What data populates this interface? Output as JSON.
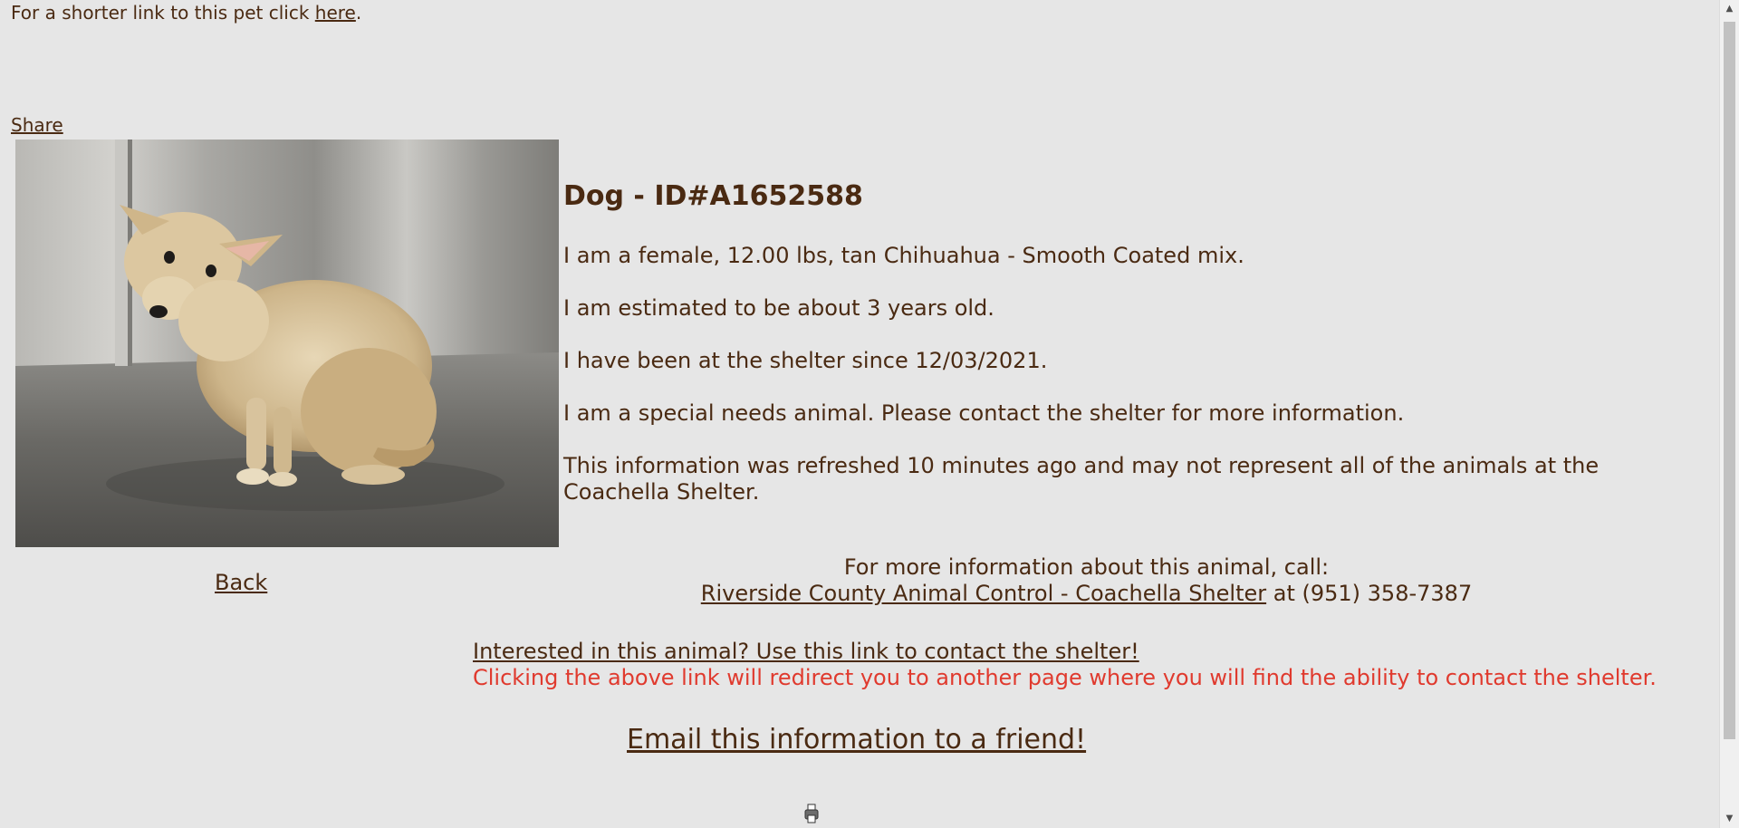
{
  "header": {
    "short_link_prefix": "For a shorter link to this pet click ",
    "short_link_label": "here",
    "short_link_suffix": ".",
    "share_label": "Share"
  },
  "pet": {
    "title": "Dog - ID#A1652588",
    "description": "I am a female, 12.00 lbs, tan Chihuahua - Smooth Coated mix.",
    "age": "I am estimated to be about 3 years old.",
    "shelter_since": "I have been at the shelter since 12/03/2021.",
    "special_needs": "I am a special needs animal. Please contact the shelter for more information.",
    "refresh_note": "This information was refreshed 10 minutes ago and may not represent all of the animals at the Coachella Shelter."
  },
  "nav": {
    "back_label": "Back"
  },
  "contact": {
    "intro": "For more information about this animal, call:",
    "shelter_name": "Riverside County Animal Control - Coachella Shelter",
    "phone_text": " at (951) 358-7387",
    "interest_link": "Interested in this animal? Use this link to contact the shelter!",
    "redirect_note": "Clicking the above link will redirect you to another page where you will find the ability to contact the shelter.",
    "email_friend": "Email this information to a friend!"
  },
  "colors": {
    "background": "#e6e6e6",
    "text": "#4a2a12",
    "warning": "#e03a2e"
  },
  "icons": {
    "scroll_up": "scroll-up-arrow-icon",
    "scroll_down": "scroll-down-arrow-icon",
    "bottom": "printer-icon"
  }
}
